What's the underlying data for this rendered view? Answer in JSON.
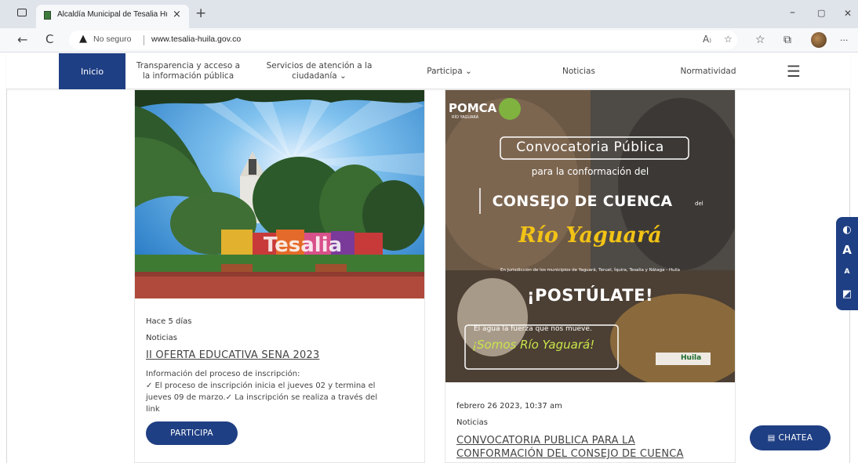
{
  "browser": {
    "tab_title": "Alcaldía Municipal de Tesalia Hu",
    "tab_close": "×",
    "new_tab": "+",
    "minimize": "–",
    "restore": "▢",
    "close": "✕",
    "not_secure_label": "No seguro",
    "url": "www.tesalia-huila.gov.co",
    "back_icon": "←",
    "reload_icon": "C",
    "more_icon": "···"
  },
  "nav": {
    "home": "Inicio",
    "transparency_line1": "Transparencia y acceso a",
    "transparency_line2": "la información pública",
    "services_line1": "Servicios de atención a la",
    "services_line2": "ciudadanía ⌄",
    "participa": "Participa ⌄",
    "noticias": "Noticias",
    "normatividad": "Normatividad"
  },
  "card1": {
    "photo_sign": "Tesalia",
    "meta_time": "Hace 5 días",
    "meta_category": "Noticias",
    "title": "II OFERTA EDUCATIVA SENA 2023",
    "desc_line1": "Información del proceso de inscripción:",
    "desc_line2": "✓ El proceso de inscripción inicia el jueves 02 y termina el",
    "desc_line3": "jueves 09 de marzo.✓ La inscripción se realiza a través del",
    "desc_line4": "link",
    "button": "PARTICIPA"
  },
  "card2": {
    "poster_logo": "POMCA",
    "poster_logo_sub": "RÍO YAGUARÁ",
    "poster_convocatoria": "Convocatoria Pública",
    "poster_para": "para la conformación del",
    "poster_consejo": "CONSEJO DE CUENCA",
    "poster_del": "del",
    "poster_rio": "Río Yaguará",
    "poster_juris": "En jurisdicción de los municipios de Yaguará, Teruel, Íquira, Tesalia y Nátaga - Huila",
    "poster_postulate": "¡POSTÚLATE!",
    "poster_agua": "El agua la fuerza que nos mueve.",
    "poster_somos": "¡Somos Río Yaguará!",
    "poster_huila": "Huila",
    "meta_date": "febrero 26 2023, 10:37 am",
    "meta_category": "Noticias",
    "title_line1": "CONVOCATORIA PUBLICA PARA LA",
    "title_line2": "CONFORMACIÓN DEL CONSEJO DE CUENCA"
  },
  "a11y": {
    "contrast": "◐",
    "increase": "A",
    "decrease": "A",
    "other": "◩"
  },
  "chat": {
    "label": "CHATEA"
  },
  "colors": {
    "primary": "#1f3f84",
    "link": "#444444"
  }
}
